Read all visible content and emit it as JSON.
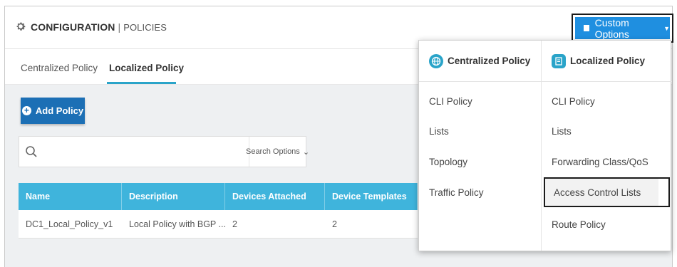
{
  "header": {
    "title_main": "CONFIGURATION",
    "title_sep": " | ",
    "title_sub": "POLICIES",
    "custom_options_label": "Custom Options",
    "icon": "gear-icon"
  },
  "tabs": [
    {
      "label": "Centralized Policy",
      "active": false
    },
    {
      "label": "Localized Policy",
      "active": true
    }
  ],
  "toolbar": {
    "add_policy_label": "Add Policy",
    "search_placeholder": "",
    "search_options_label": "Search Options"
  },
  "table": {
    "columns": [
      "Name",
      "Description",
      "Devices Attached",
      "Device Templates"
    ],
    "rows": [
      [
        "DC1_Local_Policy_v1",
        "Local Policy with BGP ...",
        "2",
        "2"
      ]
    ]
  },
  "dropdown": {
    "centralized": {
      "heading": "Centralized Policy",
      "icon": "globe-icon",
      "items": [
        "CLI Policy",
        "Lists",
        "Topology",
        "Traffic Policy"
      ]
    },
    "localized": {
      "heading": "Localized Policy",
      "icon": "document-icon",
      "items": [
        "CLI Policy",
        "Lists",
        "Forwarding Class/QoS",
        "Access Control Lists",
        "Route Policy"
      ],
      "highlighted_index": 3
    }
  },
  "colors": {
    "accent_blue": "#1f8fe0",
    "table_header": "#3fb4dc",
    "tab_underline": "#2aa4c9",
    "add_button": "#1c6fb5"
  }
}
